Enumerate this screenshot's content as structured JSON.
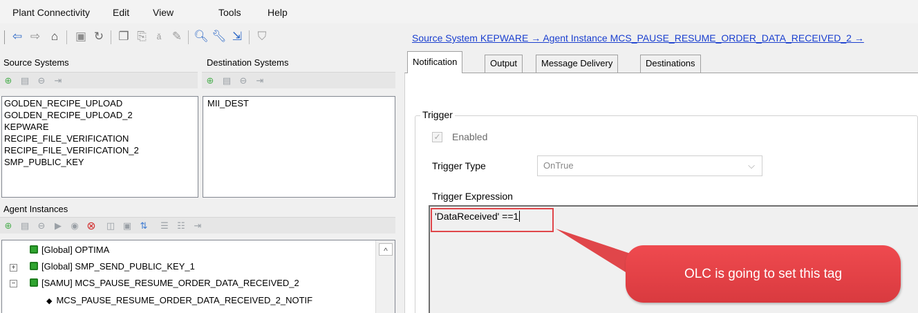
{
  "menu": [
    "Plant Connectivity",
    "Edit",
    "View",
    "Tools",
    "Help"
  ],
  "toolbar_icons": [
    "back-arrow-icon",
    "forward-arrow-icon",
    "home-icon",
    "save-icon",
    "refresh-icon",
    "copy-icon",
    "paste-icon",
    "rename-icon",
    "edit-icon",
    "search-icon",
    "wrench-icon",
    "export-icon",
    "shield-icon"
  ],
  "source_systems": {
    "title": "Source Systems",
    "items": [
      "GOLDEN_RECIPE_UPLOAD",
      "GOLDEN_RECIPE_UPLOAD_2",
      "KEPWARE",
      "RECIPE_FILE_VERIFICATION",
      "RECIPE_FILE_VERIFICATION_2",
      "SMP_PUBLIC_KEY"
    ]
  },
  "destination_systems": {
    "title": "Destination Systems",
    "items": [
      "MII_DEST"
    ]
  },
  "agent_instances": {
    "title": "Agent Instances",
    "tree": [
      {
        "label": "[Global] OPTIMA",
        "expander": ""
      },
      {
        "label": "[Global] SMP_SEND_PUBLIC_KEY_1",
        "expander": "+"
      },
      {
        "label": "[SAMU] MCS_PAUSE_RESUME_ORDER_DATA_RECEIVED_2",
        "expander": "−"
      },
      {
        "label": "MCS_PAUSE_RESUME_ORDER_DATA_RECEIVED_2_NOTIF",
        "expander": ""
      }
    ],
    "scroll_up": "^"
  },
  "breadcrumb": "Source System KEPWARE  →  Agent Instance MCS_PAUSE_RESUME_ORDER_DATA_RECEIVED_2  →",
  "tabs": [
    "Notification",
    "Output",
    "Message Delivery",
    "Destinations"
  ],
  "trigger": {
    "group_label": "Trigger",
    "enabled_label": "Enabled",
    "enabled_checked": true,
    "type_label": "Trigger Type",
    "type_value": "OnTrue",
    "expression_label": "Trigger Expression",
    "expression_value": "'DataReceived' ==1"
  },
  "annotation": {
    "text": "OLC is going to set this tag",
    "color": "#e0464a"
  }
}
